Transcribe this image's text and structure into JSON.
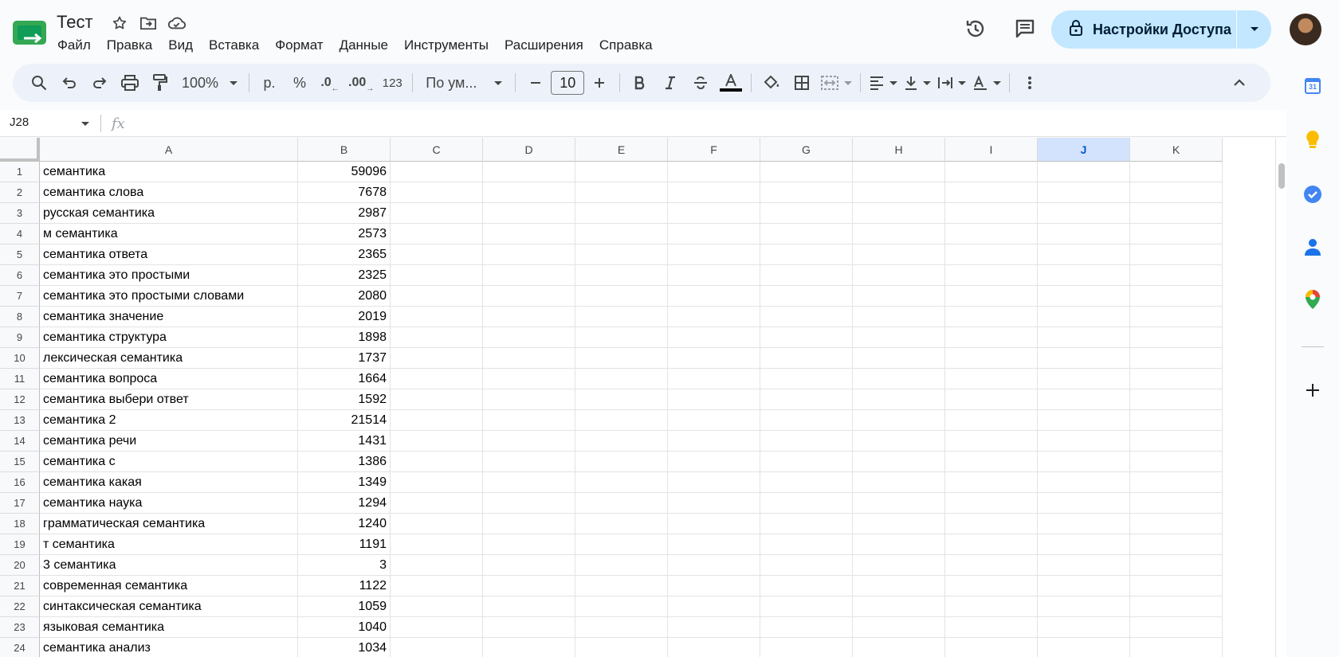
{
  "header": {
    "title": "Тест",
    "menu": [
      "Файл",
      "Правка",
      "Вид",
      "Вставка",
      "Формат",
      "Данные",
      "Инструменты",
      "Расширения",
      "Справка"
    ],
    "share_label": "Настройки Доступа"
  },
  "toolbar": {
    "zoom": "100%",
    "currency": "р.",
    "percent": "%",
    "decrease_decimal": ".0",
    "increase_decimal": ".00",
    "number_format": "123",
    "font": "По ум...",
    "font_size": "10"
  },
  "formula_bar": {
    "cell_ref": "J28",
    "fx": "fx",
    "value": ""
  },
  "sheet": {
    "columns": [
      "A",
      "B",
      "C",
      "D",
      "E",
      "F",
      "G",
      "H",
      "I",
      "J",
      "K"
    ],
    "selected_column": "J",
    "rows": [
      [
        "семантика",
        "59096"
      ],
      [
        "семантика слова",
        "7678"
      ],
      [
        "русская семантика",
        "2987"
      ],
      [
        "м семантика",
        "2573"
      ],
      [
        "семантика ответа",
        "2365"
      ],
      [
        "семантика это простыми",
        "2325"
      ],
      [
        "семантика это простыми словами",
        "2080"
      ],
      [
        "семантика значение",
        "2019"
      ],
      [
        "семантика структура",
        "1898"
      ],
      [
        "лексическая семантика",
        "1737"
      ],
      [
        "семантика вопроса",
        "1664"
      ],
      [
        "семантика выбери ответ",
        "1592"
      ],
      [
        "семантика 2",
        "21514"
      ],
      [
        "семантика речи",
        "1431"
      ],
      [
        "семантика с",
        "1386"
      ],
      [
        "семантика какая",
        "1349"
      ],
      [
        "семантика наука",
        "1294"
      ],
      [
        "грамматическая семантика",
        "1240"
      ],
      [
        "т семантика",
        "1191"
      ],
      [
        "3 семантика",
        "3"
      ],
      [
        "современная семантика",
        "1122"
      ],
      [
        "синтаксическая семантика",
        "1059"
      ],
      [
        "языковая семантика",
        "1040"
      ],
      [
        "семантика анализ",
        "1034"
      ]
    ]
  },
  "side_panel": {
    "calendar_day": "31"
  },
  "colors": {
    "accent": "#0b57d0",
    "share_bg": "#c2e7ff",
    "toolbar_bg": "#edf2fa",
    "selected_col_bg": "#d3e3fd"
  }
}
